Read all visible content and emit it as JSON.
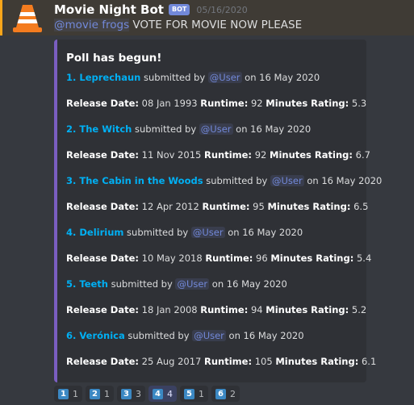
{
  "message": {
    "username": "Movie Night Bot",
    "bot_tag": "BOT",
    "timestamp": "05/16/2020",
    "mention": "@movie frogs",
    "text": " VOTE FOR MOVIE NOW PLEASE"
  },
  "embed": {
    "title": "Poll has begun!",
    "submitted_by": "submitted by",
    "on": "on",
    "release_label": "Release Date:",
    "runtime_label": "Runtime:",
    "minutes_label": "Minutes",
    "rating_label": "Rating:",
    "accent_color": "#7a5ec1",
    "movies": [
      {
        "title": "1. Leprechaun",
        "user": "@User",
        "date": "16 May 2020",
        "release": "08 Jan 1993",
        "runtime": "92",
        "rating": "5.3"
      },
      {
        "title": "2. The Witch",
        "user": "@User",
        "date": "16 May 2020",
        "release": "11 Nov 2015",
        "runtime": "92",
        "rating": "6.7"
      },
      {
        "title": "3. The Cabin in the Woods",
        "user": "@User",
        "date": "16 May 2020",
        "release": "12 Apr 2012",
        "runtime": "95",
        "rating": "6.5"
      },
      {
        "title": "4. Delirium",
        "user": "@User",
        "date": "16 May 2020",
        "release": "10 May 2018",
        "runtime": "96",
        "rating": "5.4"
      },
      {
        "title": "5. Teeth",
        "user": "@User",
        "date": "16 May 2020",
        "release": "18 Jan 2008",
        "runtime": "94",
        "rating": "5.2"
      },
      {
        "title": "6. Verónica",
        "user": "@User",
        "date": "16 May 2020",
        "release": "25 Aug 2017",
        "runtime": "105",
        "rating": "6.1"
      }
    ]
  },
  "reactions": [
    {
      "emoji": "1",
      "count": "1",
      "active": false
    },
    {
      "emoji": "2",
      "count": "1",
      "active": false
    },
    {
      "emoji": "3",
      "count": "3",
      "active": false
    },
    {
      "emoji": "4",
      "count": "4",
      "active": true
    },
    {
      "emoji": "5",
      "count": "1",
      "active": false
    },
    {
      "emoji": "6",
      "count": "2",
      "active": false
    }
  ]
}
